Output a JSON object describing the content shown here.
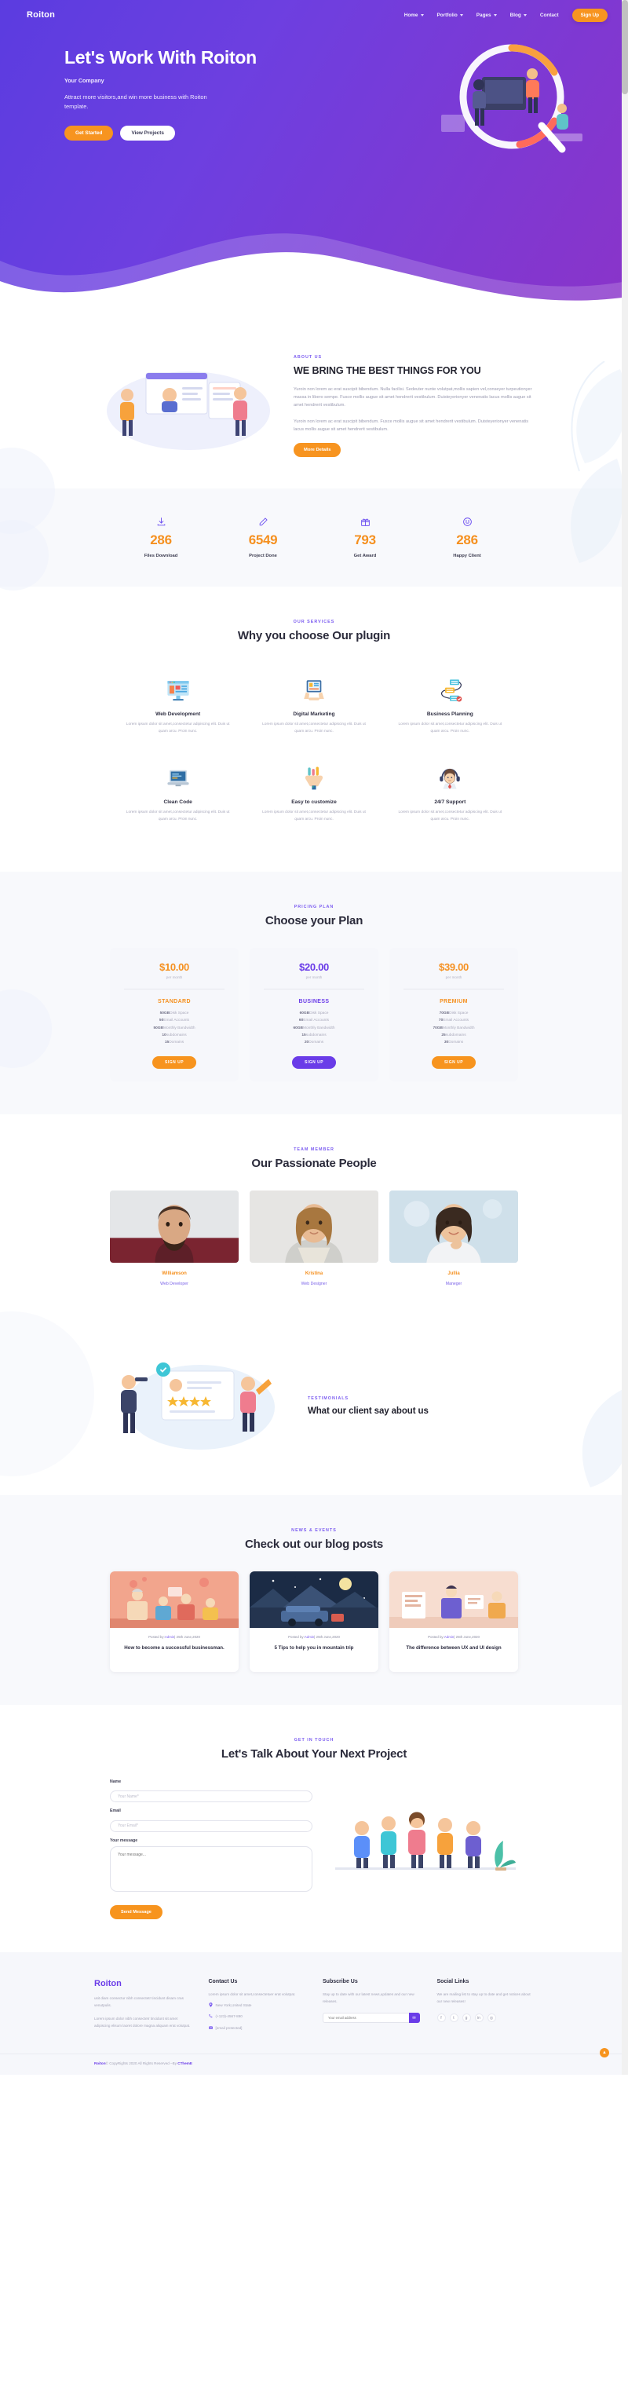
{
  "nav": {
    "brand": "Roiton",
    "links": [
      {
        "label": "Home",
        "caret": true
      },
      {
        "label": "Portfolio",
        "caret": true
      },
      {
        "label": "Pages",
        "caret": true
      },
      {
        "label": "Blog",
        "caret": true
      },
      {
        "label": "Contact",
        "caret": false
      }
    ],
    "signup": "Sign Up"
  },
  "hero": {
    "title": "Let's Work With Roiton",
    "subtitle": "Your Company",
    "description": "Attract more visitors,and win more business with Roiton template.",
    "btn_primary": "Get Started",
    "btn_secondary": "View Projects"
  },
  "about": {
    "eyebrow": "ABOUT US",
    "title": "WE BRING THE BEST THINGS FOR YOU",
    "p1": "Yuroin non lorem ac erat suscipit bibendum. Nulla facilisi. Sedeuter nunte volutpat,mollis sapien vel,conseyer turpeutionyer massa in libero sempe. Fusce mollis augue sit amet hendrerit vestibulum. Duisteyerionyer venenatis lacus mollis augue sit amet hendrerit vestibulum.",
    "p2": "Yuroin non lorem ac erat suscipit bibendum. Fusce mollis augue sit amet hendrerit vestibulum. Duisteyerionyer venenatis lacus mollis augue sit amet hendrerit vestibulum.",
    "button": "More Details"
  },
  "counters": [
    {
      "icon": "download-icon",
      "value": "286",
      "label": "Files Download"
    },
    {
      "icon": "pencil-icon",
      "value": "6549",
      "label": "Project Done"
    },
    {
      "icon": "gift-icon",
      "value": "793",
      "label": "Get Award"
    },
    {
      "icon": "smile-icon",
      "value": "286",
      "label": "Happy Client"
    }
  ],
  "services": {
    "eyebrow": "OUR SERVICES",
    "title": "Why you choose Our plugin",
    "desc": "Lorem ipsum dolor sit amet,consectetur adipiscing elit. Duis ut quam arcu. Proin nunc.",
    "items": [
      {
        "icon": "monitor-icon",
        "name": "Web Development"
      },
      {
        "icon": "tablet-hands-icon",
        "name": "Digital Marketing"
      },
      {
        "icon": "flowchart-icon",
        "name": "Business Planning"
      },
      {
        "icon": "laptop-code-icon",
        "name": "Clean Code"
      },
      {
        "icon": "hand-tools-icon",
        "name": "Easy to customize"
      },
      {
        "icon": "headset-agent-icon",
        "name": "24/7 Support"
      }
    ]
  },
  "pricing": {
    "eyebrow": "PRICING PLAN",
    "title": "Choose your Plan",
    "per_month": "per month",
    "signup_label": "SIGN UP",
    "plans": [
      {
        "price": "$10.00",
        "name": "STANDARD",
        "accent": "#f5901f",
        "btn_color": "#f7941e",
        "features": [
          {
            "value": "50GB",
            "text": "Disk Space"
          },
          {
            "value": "50",
            "text": "Email Accounts"
          },
          {
            "value": "50GB",
            "text": "Monthly Bandwidth"
          },
          {
            "value": "10",
            "text": "subdomains"
          },
          {
            "value": "15",
            "text": "Domains"
          }
        ]
      },
      {
        "price": "$20.00",
        "name": "BUSINESS",
        "accent": "#6a3ce8",
        "btn_color": "#6a3ce8",
        "features": [
          {
            "value": "60GB",
            "text": "Disk Space"
          },
          {
            "value": "60",
            "text": "Email Accounts"
          },
          {
            "value": "60GB",
            "text": "Monthly Bandwidth"
          },
          {
            "value": "15",
            "text": "subdomains"
          },
          {
            "value": "20",
            "text": "Domains"
          }
        ]
      },
      {
        "price": "$39.00",
        "name": "PREMIUM",
        "accent": "#f5901f",
        "btn_color": "#f7941e",
        "features": [
          {
            "value": "70GB",
            "text": "Disk Space"
          },
          {
            "value": "70",
            "text": "Email Accounts"
          },
          {
            "value": "70GB",
            "text": "Monthly Bandwidth"
          },
          {
            "value": "25",
            "text": "subdomains"
          },
          {
            "value": "30",
            "text": "Domains"
          }
        ]
      }
    ]
  },
  "team": {
    "eyebrow": "TEAM MEMBER",
    "title": "Our Passionate People",
    "members": [
      {
        "name": "Williamson",
        "role": "Web Developer"
      },
      {
        "name": "Kristina",
        "role": "Web Designer"
      },
      {
        "name": "Jullia",
        "role": "Maneger"
      }
    ]
  },
  "testimonials": {
    "eyebrow": "TESTIMONIALS",
    "title": "What our client say about us"
  },
  "blog": {
    "eyebrow": "NEWS & EVENTS",
    "title": "Check out our blog posts",
    "posts": [
      {
        "meta_prefix": "Posted by:",
        "author": "Admin",
        "date": "| 25th June,2020",
        "title": "How to become a successful businessman."
      },
      {
        "meta_prefix": "Posted by:",
        "author": "Admin",
        "date": "| 25th June,2020",
        "title": "5 Tips to help you in mountain trip"
      },
      {
        "meta_prefix": "Posted by:",
        "author": "Admin",
        "date": "| 25th June,2020",
        "title": "The difference between UX and UI design"
      }
    ]
  },
  "contact": {
    "eyebrow": "GET IN TOUCH",
    "title": "Let's Talk About Your Next Project",
    "name_label": "Name",
    "name_placeholder": "Your Name*",
    "email_label": "Email",
    "email_placeholder": "Your Email*",
    "message_label": "Your message",
    "message_placeholder": "Your message...",
    "submit": "Send Message"
  },
  "footer": {
    "brand": "Roiton",
    "brand_p1": "usit diam consectur nibh consectetr tincidunt disam cras venutpulis.",
    "brand_p2": "Lorem ipsum dolor nibh consectetr tincidunt sit amet adipiscing elisum laoret dolore magna aliquam erat volutpat.",
    "contact_title": "Contact Us",
    "contact_lines": [
      {
        "icon": "location-icon",
        "text": "Lorem ipsum dolor sit amet,consectetuer erat volutpat."
      },
      {
        "icon": "pin-icon",
        "text": "New York,United State"
      },
      {
        "icon": "phone-icon",
        "text": "(+123)-4567-890"
      },
      {
        "icon": "mail-icon",
        "text": "[email protected]"
      }
    ],
    "subscribe_title": "Subscribe Us",
    "subscribe_text": "Stay up to date with our latest news,updates and our new releases.",
    "subscribe_placeholder": "Your email address",
    "subscribe_btn": "✉",
    "social_title": "Social Links",
    "social_text": "We are mailing list to stay up to date and get notices about our new releases!",
    "socials": [
      "facebook-icon",
      "twitter-icon",
      "google-plus-icon",
      "linkedin-icon",
      "instagram-icon"
    ],
    "copyright_pre": "Roiton",
    "copyright_mid": "© CopyRights 2020 All Rights Reserved –By ",
    "copyright_link": "CThemE",
    "to_top": "▲"
  }
}
